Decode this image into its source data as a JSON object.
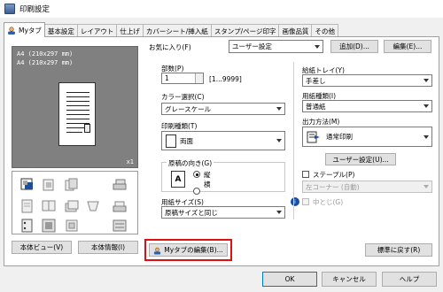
{
  "window": {
    "title": "印刷設定"
  },
  "tabs": [
    {
      "label": "Myタブ",
      "active": true
    },
    {
      "label": "基本設定"
    },
    {
      "label": "レイアウト"
    },
    {
      "label": "仕上げ"
    },
    {
      "label": "カバーシート/挿入紙"
    },
    {
      "label": "スタンプ/ページ印字"
    },
    {
      "label": "画像品質"
    },
    {
      "label": "その他"
    }
  ],
  "preview": {
    "line1": "A4 (210x297 mm)",
    "line2": "A4 (210x297 mm)",
    "copies": "x1"
  },
  "left_buttons": {
    "view": "本体ビュー(V)",
    "info": "本体情報(I)"
  },
  "favorites": {
    "label": "お気に入り(F)",
    "value": "ユーザー設定",
    "add": "追加(D)...",
    "edit": "編集(E)..."
  },
  "copies": {
    "label": "部数(P)",
    "value": "1",
    "range": "[1...9999]"
  },
  "color": {
    "label": "カラー選択(C)",
    "value": "グレースケール"
  },
  "print_type": {
    "label": "印刷種類(T)",
    "value": "両面"
  },
  "orientation": {
    "label": "原稿の向き(G)",
    "portrait": "縦",
    "landscape": "横",
    "selected": "portrait"
  },
  "paper_size": {
    "label": "用紙サイズ(S)",
    "value": "原稿サイズと同じ"
  },
  "paper_tray": {
    "label": "給紙トレイ(Y)",
    "value": "手差し"
  },
  "paper_type": {
    "label": "用紙種類(I)",
    "value": "普通紙"
  },
  "output": {
    "label": "出力方法(M)",
    "value": "通常印刷",
    "user_settings": "ユーザー設定(U)..."
  },
  "staple": {
    "label": "ステープル(P)",
    "value": "左コーナー (自動)"
  },
  "punch": {
    "label": "中とじ(G)"
  },
  "mytab_edit": "Myタブの編集(B)...",
  "restore_defaults": "標準に戻す(R)",
  "footer": {
    "ok": "OK",
    "cancel": "キャンセル",
    "help": "ヘルプ"
  },
  "colors": {
    "highlight": "#e01010",
    "accent": "#0078d7"
  }
}
